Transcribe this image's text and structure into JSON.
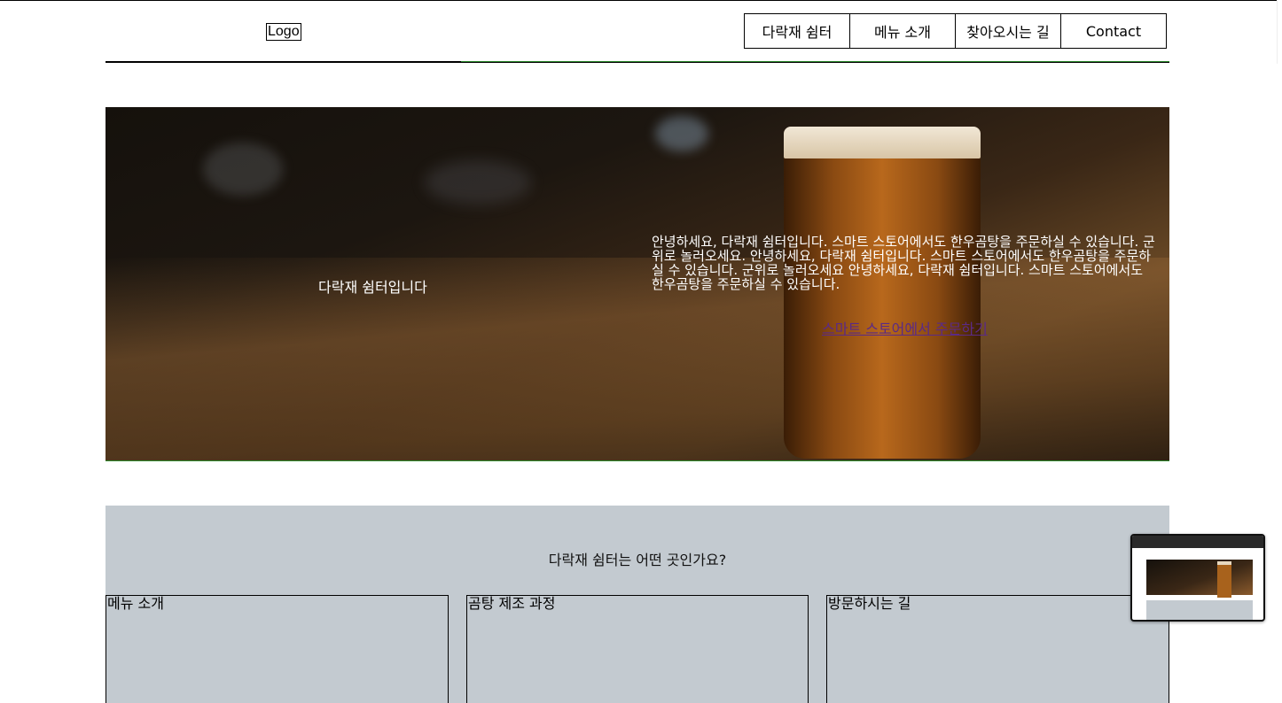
{
  "header": {
    "logo": "Logo",
    "nav": [
      {
        "label": "다락재 쉼터"
      },
      {
        "label": "메뉴 소개"
      },
      {
        "label": "찾아오시는 길"
      },
      {
        "label": "Contact"
      }
    ]
  },
  "hero": {
    "title": "다락재 쉼터입니다",
    "description": "안녕하세요, 다락재 쉼터입니다. 스마트 스토어에서도 한우곰탕을 주문하실 수 있습니다. 군위로 놀러오세요. 안녕하세요, 다락재 쉼터입니다. 스마트 스토어에서도 한우곰탕을 주문하실 수 있습니다. 군위로 놀러오세요 안녕하세요, 다락재 쉼터입니다. 스마트 스토어에서도 한우곰탕을 주문하실 수 있습니다.",
    "link_label": "스마트 스토어에서 주문하기"
  },
  "info": {
    "title": "다락재 쉼터는 어떤 곳인가요?",
    "cards": [
      {
        "label": "메뉴 소개"
      },
      {
        "label": "곰탕 제조 과정"
      },
      {
        "label": "방문하시는 길"
      }
    ]
  },
  "colors": {
    "info_background": "#c3cad0",
    "link": "#5b2a86",
    "accent_line": "#2c8a2c"
  }
}
